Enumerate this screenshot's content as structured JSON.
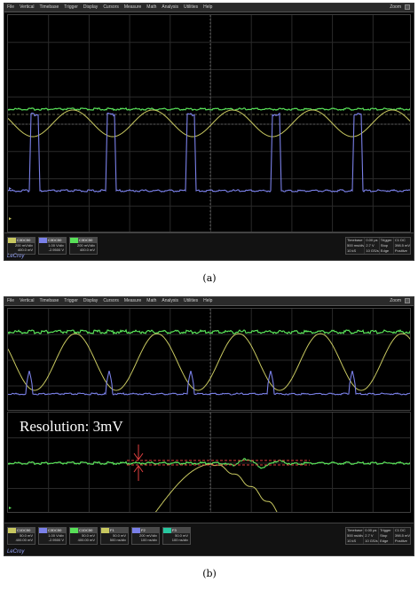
{
  "menu": [
    "File",
    "Vertical",
    "Timebase",
    "Trigger",
    "Display",
    "Cursors",
    "Measure",
    "Math",
    "Analysis",
    "Utilities",
    "Help"
  ],
  "zoom_label": "Zoom",
  "brand": "LeCroy",
  "colors": {
    "blue": "#7a80e8",
    "yellow": "#c8c860",
    "green": "#58e058",
    "red": "#e04040",
    "teal": "#28c8a0"
  },
  "panel_a": {
    "caption": "(a)",
    "descriptors": [
      {
        "name": "C3DC50",
        "lines": [
          "200 mV/div",
          "400.0 mV",
          "-1.008 kHz"
        ]
      },
      {
        "name": "C3DC50",
        "lines": [
          "1.00 V/div",
          "-2.9500 V",
          "1.004 kHz"
        ]
      },
      {
        "name": "C3DC50",
        "lines": [
          "200 mV/div",
          "400.0 mV",
          "1.004 kHz"
        ]
      }
    ],
    "timebase": [
      [
        "Timebase",
        "500 ms/div",
        "10 kS"
      ],
      [
        "0.00 μs",
        "2.7 V",
        "10 GS/s"
      ],
      [
        "Trigger",
        "Stop",
        "Edge"
      ],
      [
        "C1 DC",
        "398.5 mV",
        "Positive"
      ]
    ]
  },
  "panel_b": {
    "caption": "(b)",
    "resolution_label": "Resolution: 3mV",
    "descriptors": [
      {
        "name": "C1DC50",
        "lines": [
          "50.0 mV",
          "400.00 mV",
          "39.105 kHz"
        ]
      },
      {
        "name": "C3DC50",
        "lines": [
          "1.00 V/div",
          "-2.9500 V",
          "39.105 kHz"
        ]
      },
      {
        "name": "C1DC50",
        "lines": [
          "50.0 mV",
          "400.00 mV",
          "39.105 kHz"
        ]
      },
      {
        "name": "F1",
        "lines": [
          "50.0 mV",
          "500 ns/div",
          "39.105 kHz"
        ]
      },
      {
        "name": "F2",
        "lines": [
          "200 mV/div",
          "100 ns/div",
          "39.105 kHz"
        ]
      },
      {
        "name": "F3",
        "lines": [
          "50.0 mV",
          "100 ns/div",
          "39.105 kHz"
        ]
      }
    ],
    "timebase": [
      [
        "Timebase",
        "500 ns/div",
        "10 kS"
      ],
      [
        "0.00 μs",
        "2.7 V",
        "10 GS/s"
      ],
      [
        "Trigger",
        "Stop",
        "Edge"
      ],
      [
        "C1 DC",
        "398.5 mV",
        "Positive"
      ]
    ]
  }
}
